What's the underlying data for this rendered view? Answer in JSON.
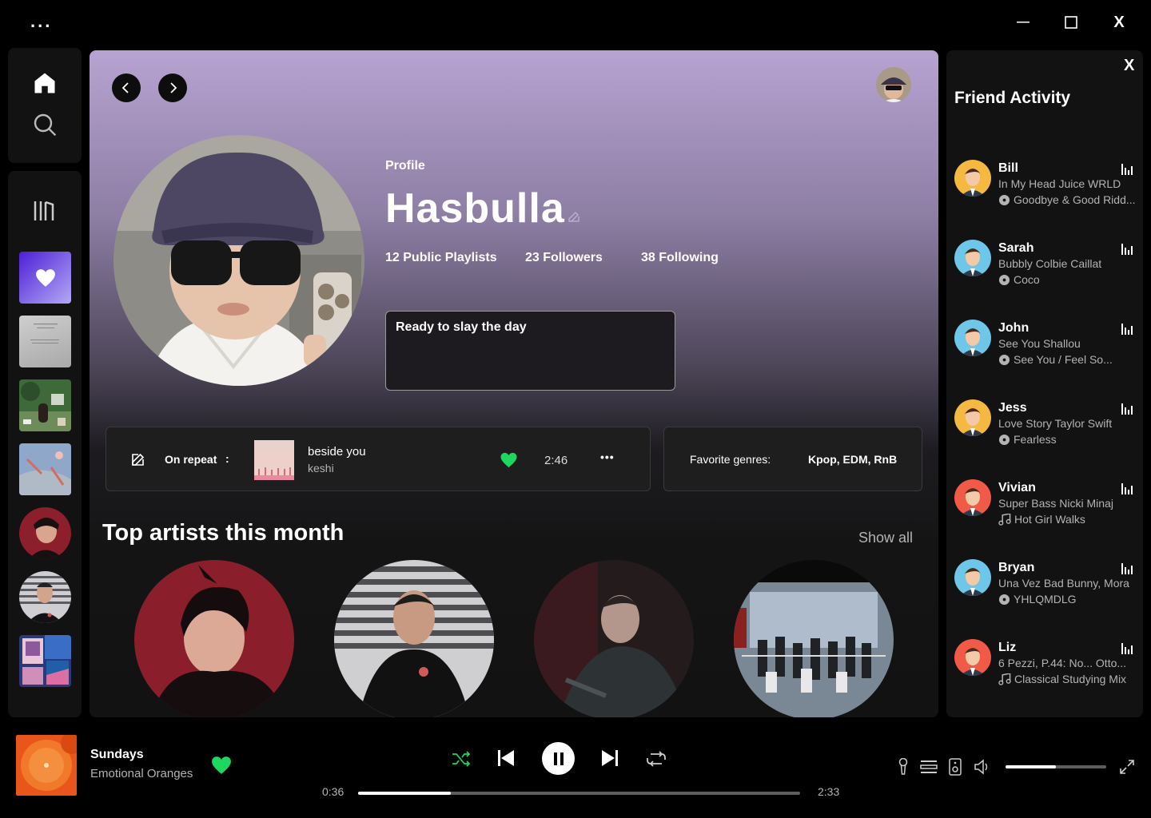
{
  "window": {
    "menu_dots": "...",
    "close_label": "X"
  },
  "profile": {
    "label": "Profile",
    "name": "Hasbulla",
    "stats": {
      "playlists": "12 Public Playlists",
      "followers": "23 Followers",
      "following": "38 Following"
    },
    "bio": "Ready to slay the day"
  },
  "on_repeat": {
    "label": "On repeat",
    "separator": ":",
    "track": "beside you",
    "artist": "keshi",
    "duration": "2:46",
    "more": "•••"
  },
  "genres": {
    "label": "Favorite genres:",
    "value": "Kpop, EDM, RnB"
  },
  "top_artists": {
    "title": "Top artists this month",
    "show_all": "Show all"
  },
  "friend_activity": {
    "title": "Friend Activity",
    "close_label": "X",
    "friends": [
      {
        "name": "Bill",
        "track": "In My Head Juice  WRLD",
        "album": "Goodbye & Good Ridd...",
        "icon": "disc-icon",
        "color": "#f5b942"
      },
      {
        "name": "Sarah",
        "track": "Bubbly Colbie Caillat",
        "album": "Coco",
        "icon": "disc-icon",
        "color": "#6ec6e8"
      },
      {
        "name": "John",
        "track": "See You Shallou",
        "album": "See You / Feel So...",
        "icon": "disc-icon",
        "color": "#6ec6e8"
      },
      {
        "name": "Jess",
        "track": "Love Story Taylor Swift",
        "album": "Fearless",
        "icon": "disc-icon",
        "color": "#f5b942"
      },
      {
        "name": "Vivian",
        "track": "Super Bass Nicki Minaj",
        "album": "Hot Girl Walks",
        "icon": "music-note-icon",
        "color": "#f05a47"
      },
      {
        "name": "Bryan",
        "track": "Una Vez Bad Bunny, Mora",
        "album": "YHLQMDLG",
        "icon": "disc-icon",
        "color": "#6ec6e8"
      },
      {
        "name": "Liz",
        "track": "6 Pezzi, P.44: No... Otto...",
        "album": "Classical Studying Mix",
        "icon": "music-note-icon",
        "color": "#f05a47"
      }
    ]
  },
  "now_playing": {
    "title": "Sundays",
    "artist": "Emotional Oranges",
    "elapsed": "0:36",
    "total": "2:33",
    "progress": 0.21,
    "volume": 0.5
  },
  "colors": {
    "accent": "#1ed760",
    "bg": "#000000",
    "panel": "#121212"
  }
}
